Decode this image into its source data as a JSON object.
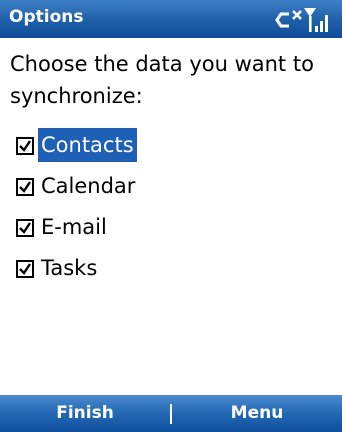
{
  "titlebar": {
    "title": "Options",
    "icons": [
      "connectivity-icon",
      "signal-strength-icon"
    ]
  },
  "prompt": "Choose the data you want to synchronize:",
  "items": [
    {
      "label": "Contacts",
      "checked": true,
      "selected": true
    },
    {
      "label": "Calendar",
      "checked": true,
      "selected": false
    },
    {
      "label": "E-mail",
      "checked": true,
      "selected": false
    },
    {
      "label": "Tasks",
      "checked": true,
      "selected": false
    }
  ],
  "softkeys": {
    "left": "Finish",
    "right": "Menu"
  },
  "colors": {
    "bar": "#1f5fa8",
    "selection": "#1e60b6",
    "text": "#000000"
  }
}
